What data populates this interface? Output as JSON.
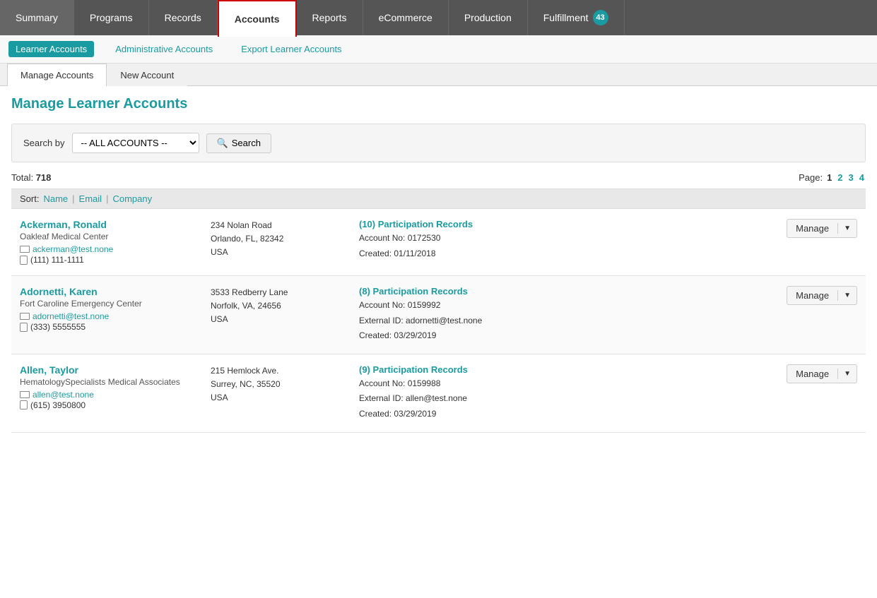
{
  "topNav": {
    "items": [
      {
        "id": "summary",
        "label": "Summary",
        "active": false
      },
      {
        "id": "programs",
        "label": "Programs",
        "active": false
      },
      {
        "id": "records",
        "label": "Records",
        "active": false
      },
      {
        "id": "accounts",
        "label": "Accounts",
        "active": true
      },
      {
        "id": "reports",
        "label": "Reports",
        "active": false
      },
      {
        "id": "ecommerce",
        "label": "eCommerce",
        "active": false
      },
      {
        "id": "production",
        "label": "Production",
        "active": false
      },
      {
        "id": "fulfillment",
        "label": "Fulfillment",
        "badge": "43",
        "active": false
      }
    ]
  },
  "subNav": {
    "items": [
      {
        "id": "learner-accounts",
        "label": "Learner Accounts",
        "active": true
      },
      {
        "id": "administrative-accounts",
        "label": "Administrative Accounts",
        "active": false
      },
      {
        "id": "export-learner-accounts",
        "label": "Export Learner Accounts",
        "active": false
      }
    ]
  },
  "pageTabs": {
    "items": [
      {
        "id": "manage-accounts",
        "label": "Manage Accounts",
        "active": true
      },
      {
        "id": "new-account",
        "label": "New Account",
        "active": false
      }
    ]
  },
  "pageTitle": "Manage Learner Accounts",
  "searchBar": {
    "label": "Search by",
    "selectValue": "-- ALL ACCOUNTS --",
    "buttonLabel": "Search"
  },
  "results": {
    "totalLabel": "Total:",
    "totalCount": "718",
    "pageLabel": "Page:",
    "pages": [
      "1",
      "2",
      "3",
      "4"
    ],
    "currentPage": "1"
  },
  "sortBar": {
    "label": "Sort:",
    "items": [
      {
        "id": "name",
        "label": "Name"
      },
      {
        "id": "email",
        "label": "Email"
      },
      {
        "id": "company",
        "label": "Company"
      }
    ]
  },
  "accounts": [
    {
      "id": "ackerman-ronald",
      "name": "Ackerman, Ronald",
      "company": "Oakleaf Medical Center",
      "email": "ackerman@test.none",
      "phone": "(111) 111-1111",
      "address1": "234 Nolan Road",
      "address2": "Orlando, FL, 82342",
      "address3": "USA",
      "recordsCount": "(10) Participation Records",
      "accountNo": "Account No: 0172530",
      "externalId": null,
      "created": "Created: 01/11/2018",
      "manageLabel": "Manage"
    },
    {
      "id": "adornetti-karen",
      "name": "Adornetti, Karen",
      "company": "Fort Caroline Emergency Center",
      "email": "adornetti@test.none",
      "phone": "(333) 5555555",
      "address1": "3533 Redberry Lane",
      "address2": "Norfolk, VA, 24656",
      "address3": "USA",
      "recordsCount": "(8) Participation Records",
      "accountNo": "Account No: 0159992",
      "externalId": "External ID: adornetti@test.none",
      "created": "Created: 03/29/2019",
      "manageLabel": "Manage"
    },
    {
      "id": "allen-taylor",
      "name": "Allen, Taylor",
      "company": "HematologySpecialists Medical Associates",
      "email": "allen@test.none",
      "phone": "(615) 3950800",
      "address1": "215 Hemlock Ave.",
      "address2": "Surrey, NC, 35520",
      "address3": "USA",
      "recordsCount": "(9) Participation Records",
      "accountNo": "Account No: 0159988",
      "externalId": "External ID: allen@test.none",
      "created": "Created: 03/29/2019",
      "manageLabel": "Manage"
    }
  ]
}
